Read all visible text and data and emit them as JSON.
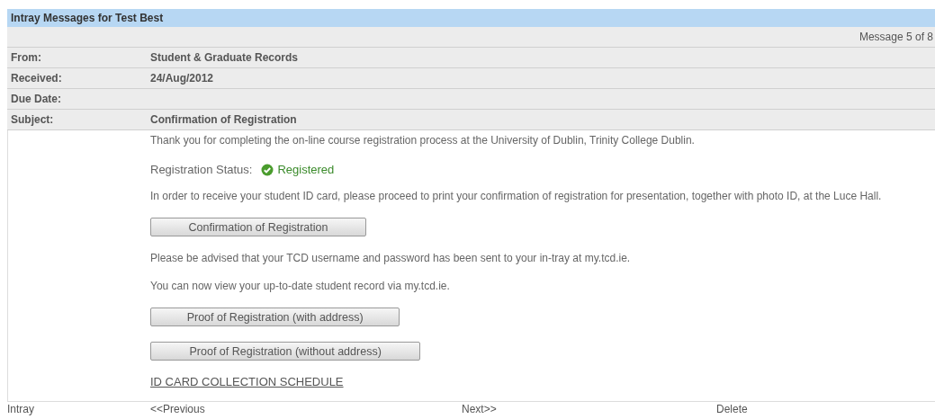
{
  "header": {
    "title": "Intray Messages for Test Best"
  },
  "counter": "Message 5 of 8",
  "fields": [
    {
      "label": "From:",
      "value": "Student & Graduate Records"
    },
    {
      "label": "Received:",
      "value": "24/Aug/2012"
    },
    {
      "label": "Due Date:"
    },
    {
      "label": "Subject:",
      "value": "Confirmation of Registration"
    }
  ],
  "body": [
    {
      "kind": "paragraph",
      "text": "Thank you for completing the on-line course registration process at the University of Dublin, Trinity College Dublin."
    },
    {
      "kind": "status",
      "label": "Registration Status:",
      "value": "Registered"
    },
    {
      "kind": "paragraph",
      "text": "In order to receive your student ID card, please proceed to print your confirmation of registration for presentation, together with photo ID, at the Luce Hall."
    },
    {
      "kind": "button",
      "text": "Confirmation of Registration"
    },
    {
      "kind": "paragraph",
      "text": "Please be advised that your TCD username and password has been sent to your in-tray at my.tcd.ie."
    },
    {
      "kind": "paragraph",
      "text": "You can now view your up-to-date student record via my.tcd.ie."
    },
    {
      "kind": "button",
      "text": "Proof of Registration (with address)"
    },
    {
      "kind": "button",
      "text": "Proof of Registration (without address)"
    },
    {
      "kind": "link",
      "text": "ID CARD COLLECTION SCHEDULE"
    }
  ],
  "footer": [
    "Intray",
    "<<Previous",
    "Next>>",
    "Delete"
  ]
}
